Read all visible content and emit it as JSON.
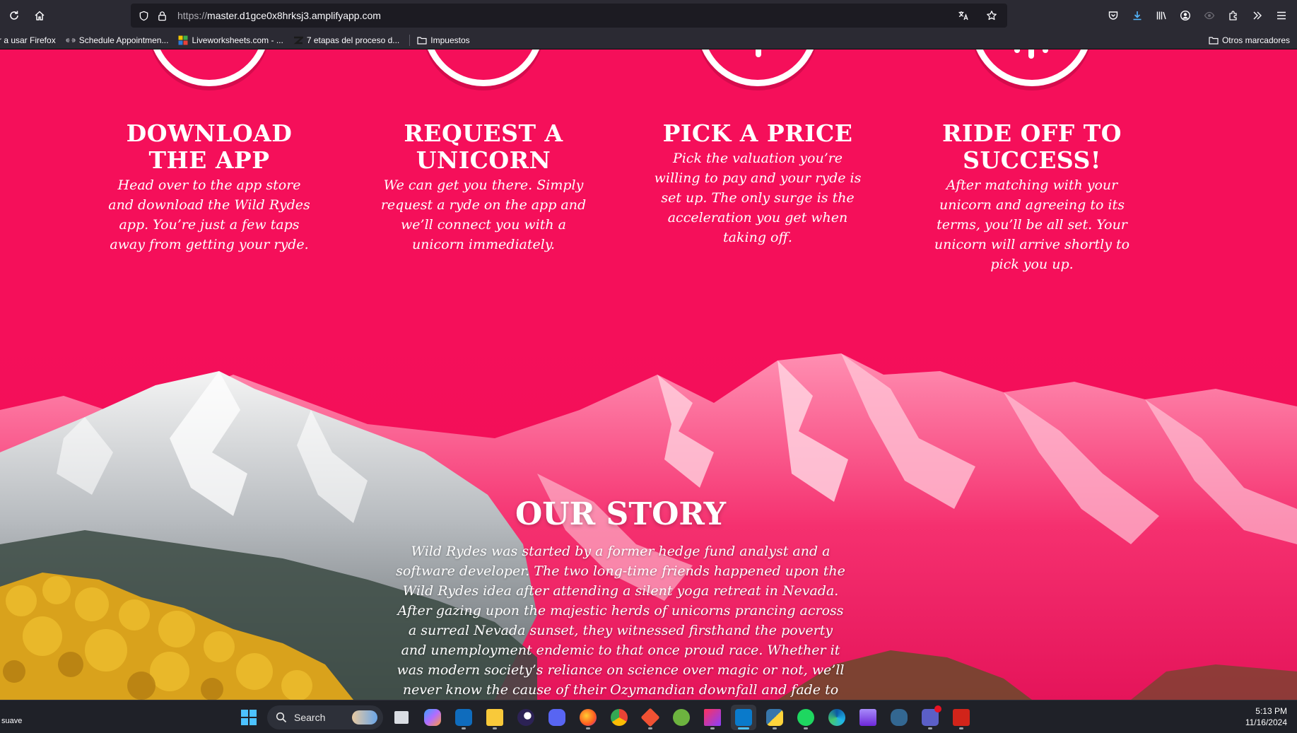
{
  "browser": {
    "url_protocol": "https://",
    "url_host": "master.d1gce0x8hrksj3.amplifyapp.com",
    "bookmarks": [
      {
        "label": "r a usar Firefox",
        "icon": "none"
      },
      {
        "label": "Schedule Appointmen...",
        "icon": "link-icon"
      },
      {
        "label": "Liveworksheets.com - ...",
        "icon": "liveworksheets-icon"
      },
      {
        "label": "7 etapas del proceso d...",
        "icon": "site-icon"
      },
      {
        "label": "Impuestos",
        "icon": "folder-icon"
      }
    ],
    "other_bookmarks": "Otros marcadores"
  },
  "steps": [
    {
      "title": "DOWNLOAD THE APP",
      "text": "Head over to the app store and download the Wild Rydes app. You’re just a few taps away from getting your ryde."
    },
    {
      "title": "REQUEST A UNICORN",
      "text": "We can get you there. Simply request a ryde on the app and we’ll connect you with a unicorn immediately."
    },
    {
      "title": "PICK A PRICE",
      "text": "Pick the valuation you’re willing to pay and your ryde is set up. The only surge is the acceleration you get when taking off."
    },
    {
      "title": "RIDE OFF TO SUCCESS!",
      "text": "After matching with your unicorn and agreeing to its terms, you’ll be all set. Your unicorn will arrive shortly to pick you up."
    }
  ],
  "story": {
    "title": "OUR STORY",
    "text": "Wild Rydes was started by a former hedge fund analyst and a software developer. The two long-time friends happened upon the Wild Rydes idea after attending a silent yoga retreat in Nevada. After gazing upon the majestic herds of unicorns prancing across a surreal Nevada sunset, they witnessed firsthand the poverty and unemployment endemic to that once proud race. Whether it was modern society’s reliance on science over magic or not, we’ll never know the cause of their Ozymandian downfall and fade to"
  },
  "status_text": "suave",
  "taskbar": {
    "search_label": "Search",
    "apps": [
      "file-explorer-icon",
      "copilot-icon",
      "outlook-icon",
      "folder-icon",
      "eclipse-icon",
      "discord-icon",
      "firefox-icon",
      "chrome-icon",
      "git-icon",
      "spring-icon",
      "intellij-icon",
      "vscode-icon",
      "python-icon",
      "spotify-icon",
      "edge-icon",
      "clapper-icon",
      "postgres-icon",
      "teams-icon",
      "acrobat-icon"
    ],
    "time": "5:13 PM",
    "date": "11/16/2024"
  },
  "colors": {
    "brand_pink": "#f50f5a",
    "chrome": "#2b2a33"
  }
}
